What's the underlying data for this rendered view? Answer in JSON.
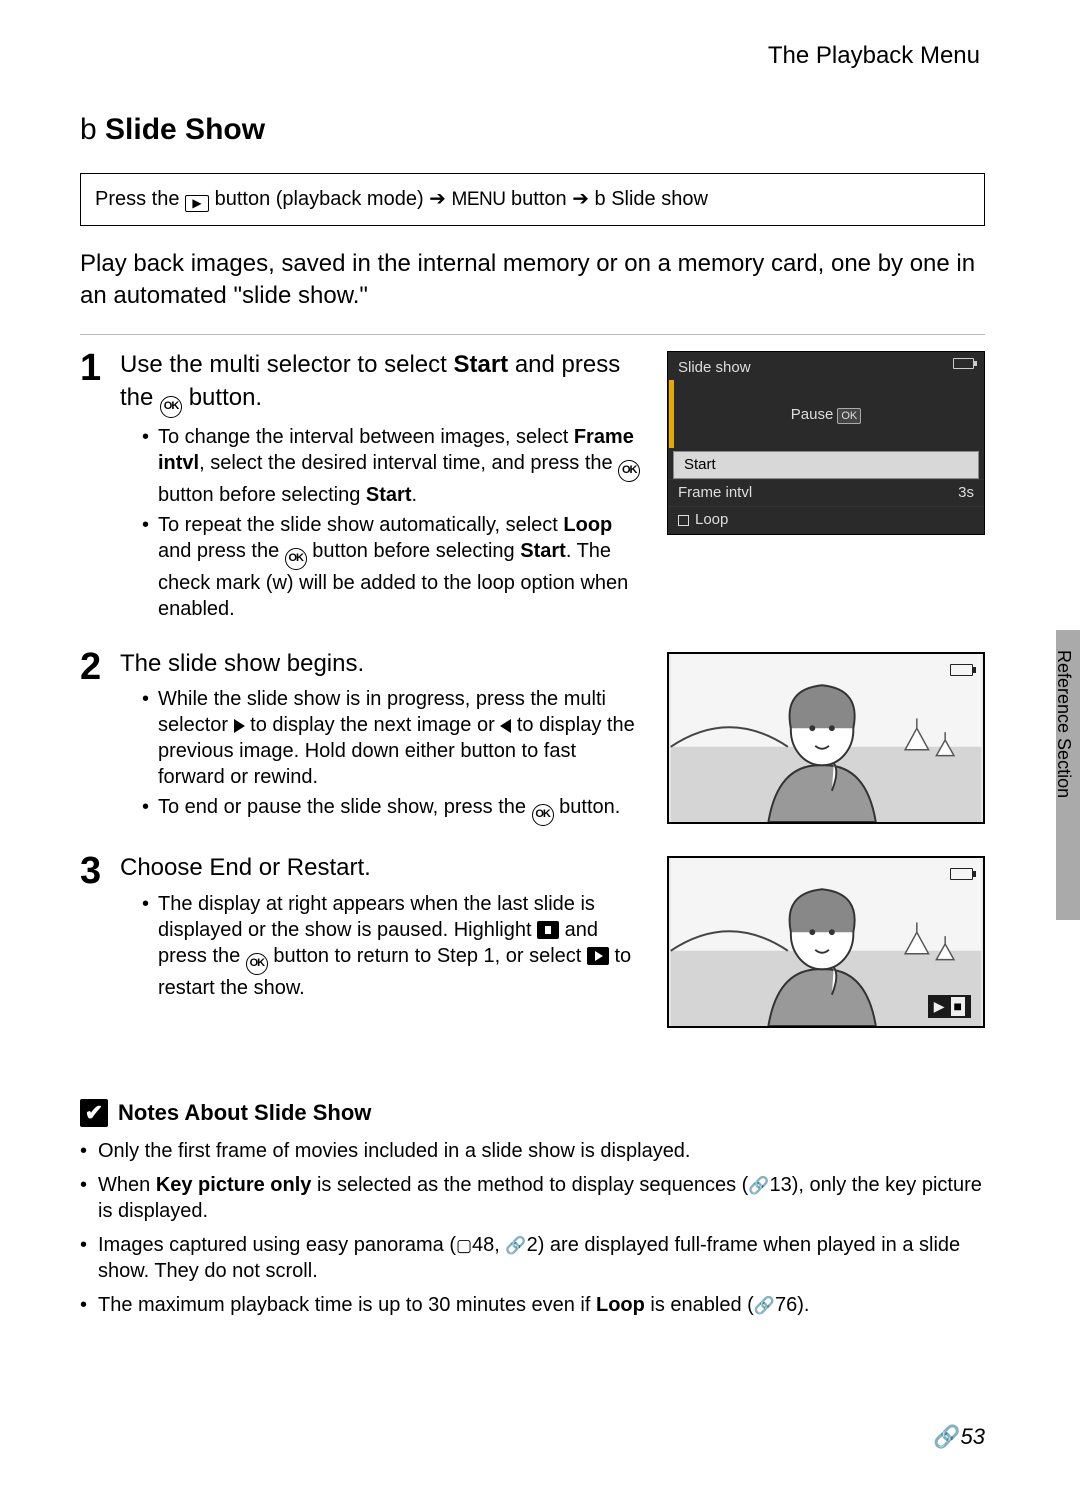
{
  "header": {
    "section": "The Playback Menu"
  },
  "title": {
    "prefix": "b",
    "main": "Slide Show"
  },
  "nav_path": {
    "press": "Press the ",
    "playback_mode": " button (playback mode) ",
    "menu_label": "MENU",
    "button_word": " button ",
    "prefix2": " b ",
    "item": "Slide show"
  },
  "intro": "Play back images, saved in the internal memory or on a memory card, one by one in an automated \"slide show.\"",
  "steps": {
    "s1": {
      "num": "1",
      "head_a": "Use the multi selector to select ",
      "head_b": "Start",
      "head_c": " and press the ",
      "head_d": " button.",
      "b1a": "To change the interval between images, select ",
      "b1b": "Frame intvl",
      "b1c": ", select the desired interval time, and press the ",
      "b1d": " button before selecting ",
      "b1e": "Start",
      "b1f": ".",
      "b2a": "To repeat the slide show automatically, select ",
      "b2b": "Loop",
      "b2c": " and press the ",
      "b2d": " button before selecting ",
      "b2e": "Start",
      "b2f": ". The check mark (w",
      "b2g": ") will be added to the loop option when enabled."
    },
    "s2": {
      "num": "2",
      "head": "The slide show begins.",
      "b1a": "While the slide show is in progress, press the multi selector ",
      "b1b": " to display the next image or ",
      "b1c": " to display the previous image. Hold down either button to fast forward or rewind.",
      "b2a": "To end or pause the slide show, press the ",
      "b2b": " button."
    },
    "s3": {
      "num": "3",
      "head": "Choose End or Restart.",
      "b1a": "The display at right appears when the last slide is displayed or the show is paused. Highlight ",
      "b1b": " and press the ",
      "b1c": " button to return to Step 1, or select ",
      "b1d": " to restart the show."
    }
  },
  "camera_screen": {
    "title": "Slide show",
    "pause": "Pause",
    "start": "Start",
    "frame": "Frame intvl",
    "frame_val": "3s",
    "loop": "Loop"
  },
  "notes": {
    "heading": "Notes About Slide Show",
    "n1": "Only the first frame of movies included in a slide show is displayed.",
    "n2a": "When ",
    "n2b": "Key picture only",
    "n2c": " is selected as the method to display sequences (",
    "n2d": "13), only the key picture is displayed.",
    "n3a": "Images captured using easy panorama (",
    "n3b": "48, ",
    "n3c": "2) are displayed full-frame when played in a slide show. They do not scroll.",
    "n4a": "The maximum playback time is up to 30 minutes even if ",
    "n4b": "Loop",
    "n4c": " is enabled (",
    "n4d": "76)."
  },
  "side_label": "Reference Section",
  "page_number": "53",
  "icons": {
    "ok": "OK",
    "play": "▶",
    "arrow": "➔",
    "ref": "🔗",
    "book": "📖",
    "check": "✔"
  }
}
